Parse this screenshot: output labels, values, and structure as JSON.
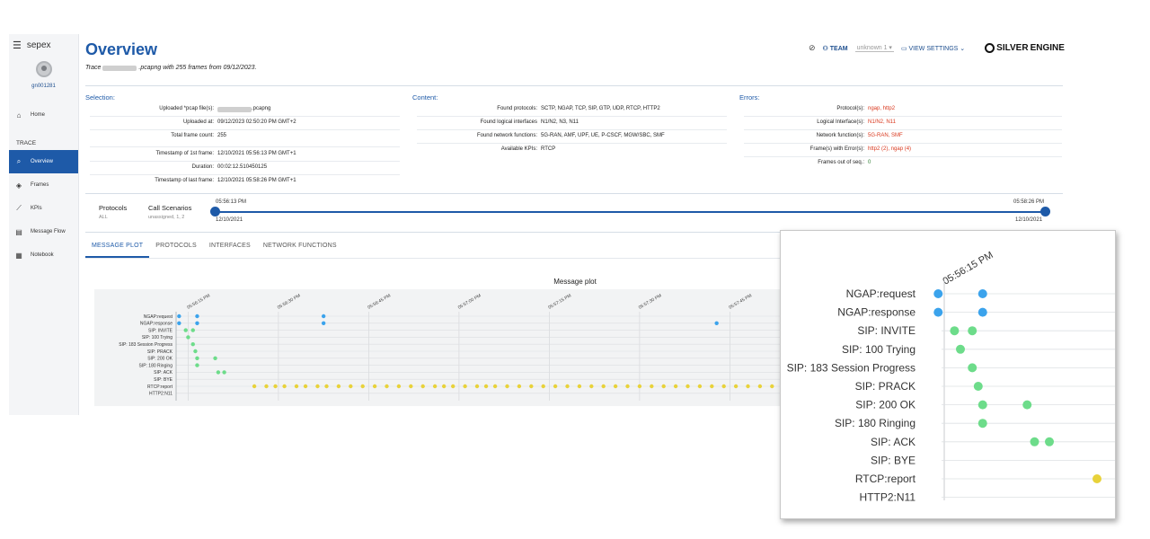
{
  "sidebar": {
    "app_name": "sepex",
    "user_id": "gn001281",
    "home": "Home",
    "section": "TRACE",
    "items": [
      {
        "label": "Overview",
        "icon": "search-doc-icon"
      },
      {
        "label": "Frames",
        "icon": "layers-icon"
      },
      {
        "label": "KPIs",
        "icon": "trend-icon"
      },
      {
        "label": "Message Flow",
        "icon": "chat-icon"
      },
      {
        "label": "Notebook",
        "icon": "calendar-icon"
      }
    ]
  },
  "header": {
    "title": "Overview",
    "trace_prefix": "Trace",
    "trace_suffix": ".pcapng with 255 frames from 09/12/2023.",
    "team_label": "TEAM",
    "team_value": "unknown 1",
    "view_settings": "VIEW SETTINGS",
    "logo_a": "SILVER",
    "logo_b": "ENGINE"
  },
  "selection": {
    "heading": "Selection:",
    "uploaded_files_k": "Uploaded *pcap file(s):",
    "uploaded_files_v": ".pcapng",
    "uploaded_at_k": "Uploaded at:",
    "uploaded_at_v": "09/12/2023 02:50:20 PM GMT+2",
    "total_k": "Total frame count:",
    "total_v": "255",
    "ts_first_k": "Timestamp of 1st frame:",
    "ts_first_v": "12/10/2021 05:56:13 PM GMT+1",
    "duration_k": "Duration:",
    "duration_v": "00:02:12.510450125",
    "ts_last_k": "Timestamp of last frame:",
    "ts_last_v": "12/10/2021 05:58:26 PM GMT+1"
  },
  "content": {
    "heading": "Content:",
    "protocols_k": "Found protocols:",
    "protocols_v": "SCTP, NGAP, TCP, SIP, GTP, UDP, RTCP, HTTP2",
    "interfaces_k": "Found logical interfaces",
    "interfaces_v": "N1/N2, N3, N11",
    "nfs_k": "Found network functions:",
    "nfs_v": "5G-RAN, AMF, UPF, UE, P-CSCF, MGW/SBC, SMF",
    "kpis_k": "Available KPIs:",
    "kpis_v": "RTCP"
  },
  "errors": {
    "heading": "Errors:",
    "protocols_k": "Protocol(s):",
    "protocols_v": "ngap, http2",
    "interfaces_k": "Logical Interface(s):",
    "interfaces_v": "N1/N2, N11",
    "nfs_k": "Network function(s):",
    "nfs_v": "5G-RAN, SMF",
    "frames_k": "Frame(s) with Error(s):",
    "frames_v": "http2 (2), ngap (4)",
    "outseq_k": "Frames out of seq.:",
    "outseq_v": "0"
  },
  "timeline": {
    "protocols_label": "Protocols",
    "protocols_sub": "ALL",
    "scenarios_label": "Call Scenarios",
    "scenarios_sub": "unassigned, 1, 2",
    "start_time": "05:56:13 PM",
    "start_date": "12/10/2021",
    "end_time": "05:58:26 PM",
    "end_date": "12/10/2021"
  },
  "tabs": [
    "MESSAGE PLOT",
    "PROTOCOLS",
    "INTERFACES",
    "NETWORK FUNCTIONS"
  ],
  "chart_data": {
    "type": "scatter",
    "title": "Message plot",
    "categories": [
      "NGAP:request",
      "NGAP:response",
      "SIP: INVITE",
      "SIP: 100 Trying",
      "SIP: 183 Session Progress",
      "SIP: PRACK",
      "SIP: 200 OK",
      "SIP: 180 Ringing",
      "SIP: ACK",
      "SIP: BYE",
      "RTCP:report",
      "HTTP2:N11"
    ],
    "x_ticks": [
      "05:56:15 PM",
      "05:56:30 PM",
      "05:56:45 PM",
      "05:57:00 PM",
      "05:57:15 PM",
      "05:57:30 PM",
      "05:57:45 PM"
    ],
    "colors": {
      "NGAP": "#3ba3ec",
      "SIP": "#6ddc8a",
      "RTCP": "#e8d23a",
      "error": "#e53a2a"
    },
    "points": [
      {
        "row": 0,
        "t": [
          13.5,
          16.5,
          37.5
        ]
      },
      {
        "row": 1,
        "t": [
          13.5,
          16.5,
          37.5,
          102.8
        ]
      },
      {
        "row": 2,
        "t": [
          14.6,
          15.8
        ]
      },
      {
        "row": 3,
        "t": [
          15.0
        ]
      },
      {
        "row": 4,
        "t": [
          15.8
        ]
      },
      {
        "row": 5,
        "t": [
          16.2
        ]
      },
      {
        "row": 6,
        "t": [
          16.5,
          19.5
        ]
      },
      {
        "row": 7,
        "t": [
          16.5
        ]
      },
      {
        "row": 8,
        "t": [
          20.0,
          21.0
        ]
      },
      {
        "row": 10,
        "t": [
          26,
          28,
          29.5,
          31,
          33,
          34.5,
          36.5,
          38,
          40,
          42,
          44,
          46,
          48,
          50,
          52,
          54,
          56,
          57.5,
          59,
          61,
          63,
          64.5,
          66,
          68,
          70,
          72,
          74,
          76,
          78,
          80,
          82,
          84,
          86,
          88,
          90,
          92,
          94,
          96,
          98,
          100,
          102,
          104,
          106,
          108,
          110,
          112,
          114,
          116,
          118
        ]
      }
    ],
    "error_points": [
      {
        "row": 0,
        "t": 102.8
      }
    ],
    "inset": {
      "time_label": "05:56:15 PM",
      "rows": [
        "NGAP:request",
        "NGAP:response",
        "SIP: INVITE",
        "SIP: 100 Trying",
        "SIP: 183 Session Progress",
        "SIP: PRACK",
        "SIP: 200 OK",
        "SIP: 180 Ringing",
        "SIP: ACK",
        "SIP: BYE",
        "RTCP:report",
        "HTTP2:N11"
      ]
    }
  }
}
